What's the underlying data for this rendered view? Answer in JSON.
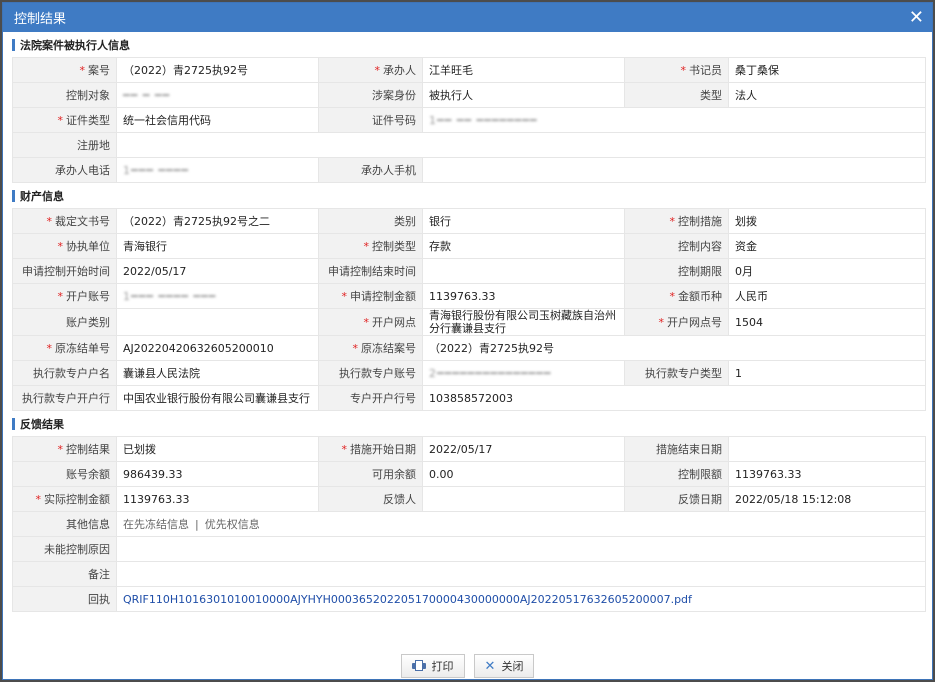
{
  "window": {
    "title": "控制结果"
  },
  "sections": {
    "party": "法院案件被执行人信息",
    "property": "财产信息",
    "feedback": "反馈结果"
  },
  "party": {
    "case_no_label": "案号",
    "case_no": "（2022）青2725执92号",
    "handler_label": "承办人",
    "handler": "江羊旺毛",
    "clerk_label": "书记员",
    "clerk": "桑丁桑保",
    "target_label": "控制对象",
    "target": "━━ ━ ━━",
    "role_label": "涉案身份",
    "role": "被执行人",
    "type_label": "类型",
    "type": "法人",
    "id_type_label": "证件类型",
    "id_type": "统一社会信用代码",
    "id_no_label": "证件号码",
    "id_no": "1━━ ━━ ━━━━━━━━",
    "reg_addr_label": "注册地",
    "reg_addr": "",
    "handler_phone_label": "承办人电话",
    "handler_phone": "1━━━ ━━━━",
    "handler_mobile_label": "承办人手机",
    "handler_mobile": ""
  },
  "property": {
    "ruling_label": "裁定文书号",
    "ruling": "（2022）青2725执92号之二",
    "category_label": "类别",
    "category": "银行",
    "measure_label": "控制措施",
    "measure": "划拨",
    "assist_label": "协执单位",
    "assist": "青海银行",
    "ctrl_type_label": "控制类型",
    "ctrl_type": "存款",
    "ctrl_content_label": "控制内容",
    "ctrl_content": "资金",
    "apply_start_label": "申请控制开始时间",
    "apply_start": "2022/05/17",
    "apply_end_label": "申请控制结束时间",
    "apply_end": "",
    "period_label": "控制期限",
    "period": "0月",
    "account_label": "开户账号",
    "account": "1━━━ ━━━━ ━━━",
    "apply_amount_label": "申请控制金额",
    "apply_amount": "1139763.33",
    "currency_label": "金额币种",
    "currency": "人民币",
    "account_kind_label": "账户类别",
    "account_kind": "",
    "branch_label": "开户网点",
    "branch": "青海银行股份有限公司玉树藏族自治州分行囊谦县支行",
    "branch_no_label": "开户网点号",
    "branch_no": "1504",
    "orig_freeze_label": "原冻结单号",
    "orig_freeze": "AJ20220420632605200010",
    "orig_case_label": "原冻结案号",
    "orig_case": "（2022）青2725执92号",
    "exec_name_label": "执行款专户户名",
    "exec_name": "囊谦县人民法院",
    "exec_acct_label": "执行款专户账号",
    "exec_acct": "2━━━━━━━━━━━━━━━",
    "exec_type_label": "执行款专户类型",
    "exec_type": "1",
    "exec_bank_label": "执行款专户开户行",
    "exec_bank": "中国农业银行股份有限公司囊谦县支行",
    "exec_bank_no_label": "专户开户行号",
    "exec_bank_no": "103858572003"
  },
  "feedback": {
    "result_label": "控制结果",
    "result": "已划拨",
    "start_label": "措施开始日期",
    "start": "2022/05/17",
    "end_label": "措施结束日期",
    "end": "",
    "balance_label": "账号余额",
    "balance": "986439.33",
    "available_label": "可用余额",
    "available": "0.00",
    "limit_label": "控制限额",
    "limit": "1139763.33",
    "actual_label": "实际控制金额",
    "actual": "1139763.33",
    "reporter_label": "反馈人",
    "reporter": "",
    "date_label": "反馈日期",
    "date": "2022/05/18 15:12:08",
    "other_label": "其他信息",
    "other_link1": "在先冻结信息",
    "other_sep": "|",
    "other_link2": "优先权信息",
    "reason_label": "未能控制原因",
    "reason": "",
    "remark_label": "备注",
    "remark": "",
    "receipt_label": "回执",
    "receipt": "QRIF110H1016301010010000AJYHYH000365202205170000430000000AJ20220517632605200007.pdf"
  },
  "buttons": {
    "print": "打印",
    "close": "关闭"
  }
}
